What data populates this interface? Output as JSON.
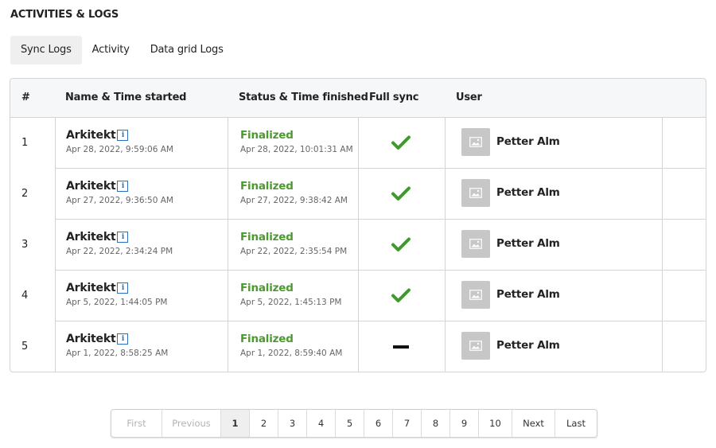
{
  "page": {
    "title": "ACTIVITIES & LOGS"
  },
  "tabs": [
    {
      "label": "Sync Logs",
      "active": true
    },
    {
      "label": "Activity",
      "active": false
    },
    {
      "label": "Data grid Logs",
      "active": false
    }
  ],
  "table": {
    "headers": {
      "num": "#",
      "name": "Name & Time started",
      "status": "Status & Time finished",
      "full_sync": "Full sync",
      "user": "User"
    },
    "rows": [
      {
        "num": "1",
        "name": "Arkitekt",
        "started": "Apr 28, 2022, 9:59:06 AM",
        "status": "Finalized",
        "finished": "Apr 28, 2022, 10:01:31 AM",
        "full_sync": true,
        "user": "Petter Alm"
      },
      {
        "num": "2",
        "name": "Arkitekt",
        "started": "Apr 27, 2022, 9:36:50 AM",
        "status": "Finalized",
        "finished": "Apr 27, 2022, 9:38:42 AM",
        "full_sync": true,
        "user": "Petter Alm"
      },
      {
        "num": "3",
        "name": "Arkitekt",
        "started": "Apr 22, 2022, 2:34:24 PM",
        "status": "Finalized",
        "finished": "Apr 22, 2022, 2:35:54 PM",
        "full_sync": true,
        "user": "Petter Alm"
      },
      {
        "num": "4",
        "name": "Arkitekt",
        "started": "Apr 5, 2022, 1:44:05 PM",
        "status": "Finalized",
        "finished": "Apr 5, 2022, 1:45:13 PM",
        "full_sync": true,
        "user": "Petter Alm"
      },
      {
        "num": "5",
        "name": "Arkitekt",
        "started": "Apr 1, 2022, 8:58:25 AM",
        "status": "Finalized",
        "finished": "Apr 1, 2022, 8:59:40 AM",
        "full_sync": false,
        "user": "Petter Alm"
      }
    ]
  },
  "icons": {
    "info": "info-icon",
    "check": "checkmark-icon",
    "dash": "dash-icon",
    "avatar": "image-placeholder-icon"
  },
  "colors": {
    "status_green": "#4a9a2e",
    "check_green": "#3f9a2a",
    "info_blue": "#2a6fb8"
  },
  "pagination": {
    "items": [
      {
        "label": "First",
        "state": "disabled"
      },
      {
        "label": "Previous",
        "state": "disabled"
      },
      {
        "label": "1",
        "state": "active"
      },
      {
        "label": "2",
        "state": "normal"
      },
      {
        "label": "3",
        "state": "normal"
      },
      {
        "label": "4",
        "state": "normal"
      },
      {
        "label": "5",
        "state": "normal"
      },
      {
        "label": "6",
        "state": "normal"
      },
      {
        "label": "7",
        "state": "normal"
      },
      {
        "label": "8",
        "state": "normal"
      },
      {
        "label": "9",
        "state": "normal"
      },
      {
        "label": "10",
        "state": "normal"
      },
      {
        "label": "Next",
        "state": "normal"
      },
      {
        "label": "Last",
        "state": "normal"
      }
    ]
  }
}
